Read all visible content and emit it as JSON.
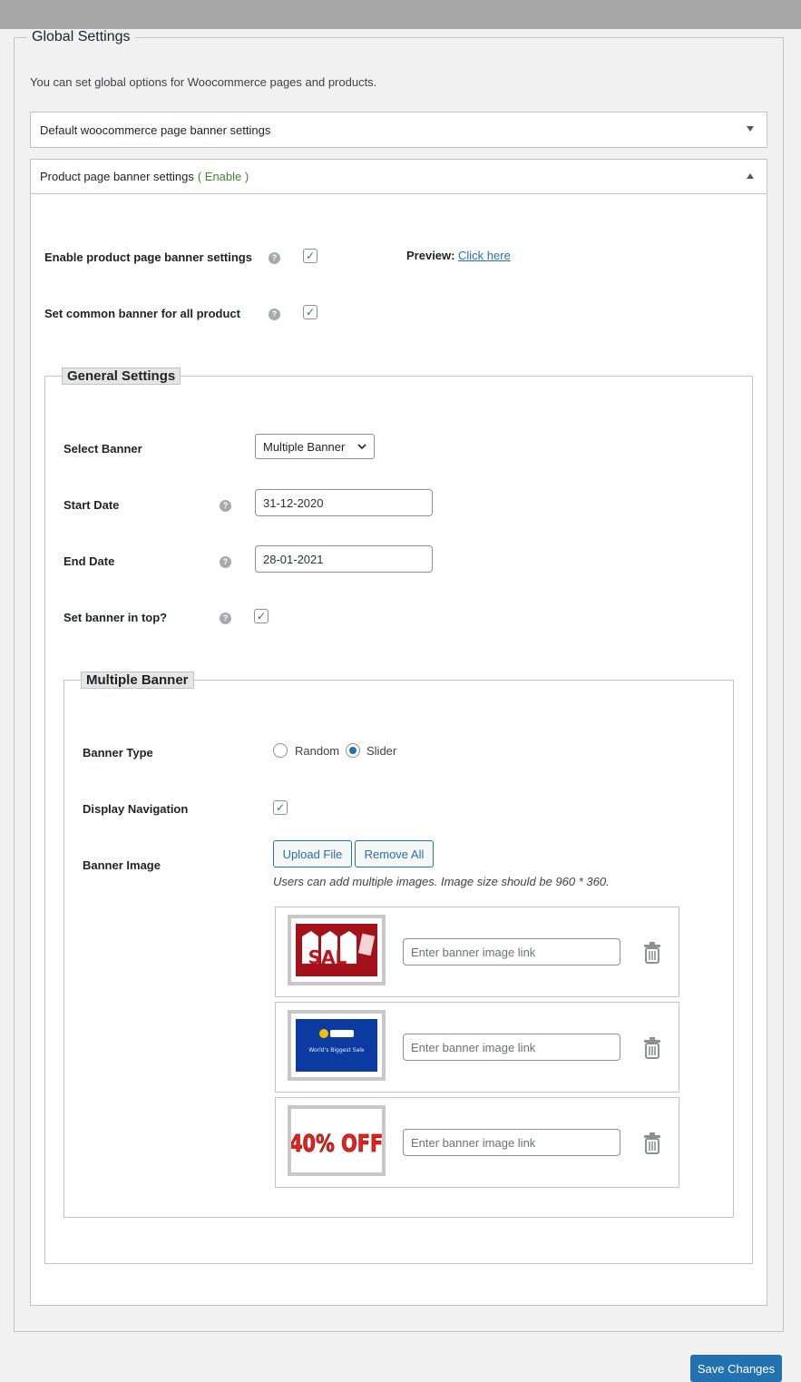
{
  "global": {
    "title": "Global Settings",
    "description": "You can set global options for Woocommerce pages and products."
  },
  "accordion1": {
    "title": "Default woocommerce page banner settings"
  },
  "accordion2": {
    "title": "Product page banner settings",
    "status": "( Enable )"
  },
  "product": {
    "enable_label": "Enable product page banner settings",
    "enable_checked": true,
    "preview_label": "Preview:",
    "preview_link": "Click here",
    "common_label": "Set common banner for all product",
    "common_checked": true
  },
  "general": {
    "legend": "General Settings",
    "select_banner_label": "Select Banner",
    "select_banner_value": "Multiple Banner",
    "start_date_label": "Start Date",
    "start_date_value": "31-12-2020",
    "end_date_label": "End Date",
    "end_date_value": "28-01-2021",
    "top_label": "Set banner in top?",
    "top_checked": true
  },
  "multiple": {
    "legend": "Multiple Banner",
    "banner_type_label": "Banner Type",
    "options": [
      "Random",
      "Slider"
    ],
    "selected": "Slider",
    "nav_label": "Display Navigation",
    "nav_checked": true,
    "image_label": "Banner Image",
    "upload_btn": "Upload File",
    "remove_btn": "Remove All",
    "note": "Users can add multiple images. Image size should be 960 * 360.",
    "banners": [
      {
        "thumb_text": "SAL",
        "placeholder": "Enter banner image link"
      },
      {
        "thumb_text": "World's Biggest Sale",
        "placeholder": "Enter banner image link"
      },
      {
        "thumb_text": "40% OFF",
        "placeholder": "Enter banner image link"
      }
    ]
  },
  "save_btn": "Save Changes",
  "colors": {
    "accent": "#2271b1",
    "enable": "#3a8b2c"
  },
  "icons": {
    "checkbox": "checkmark-icon",
    "help": "help-icon",
    "trash": "trash-icon",
    "chevron": "chevron-down-icon"
  }
}
